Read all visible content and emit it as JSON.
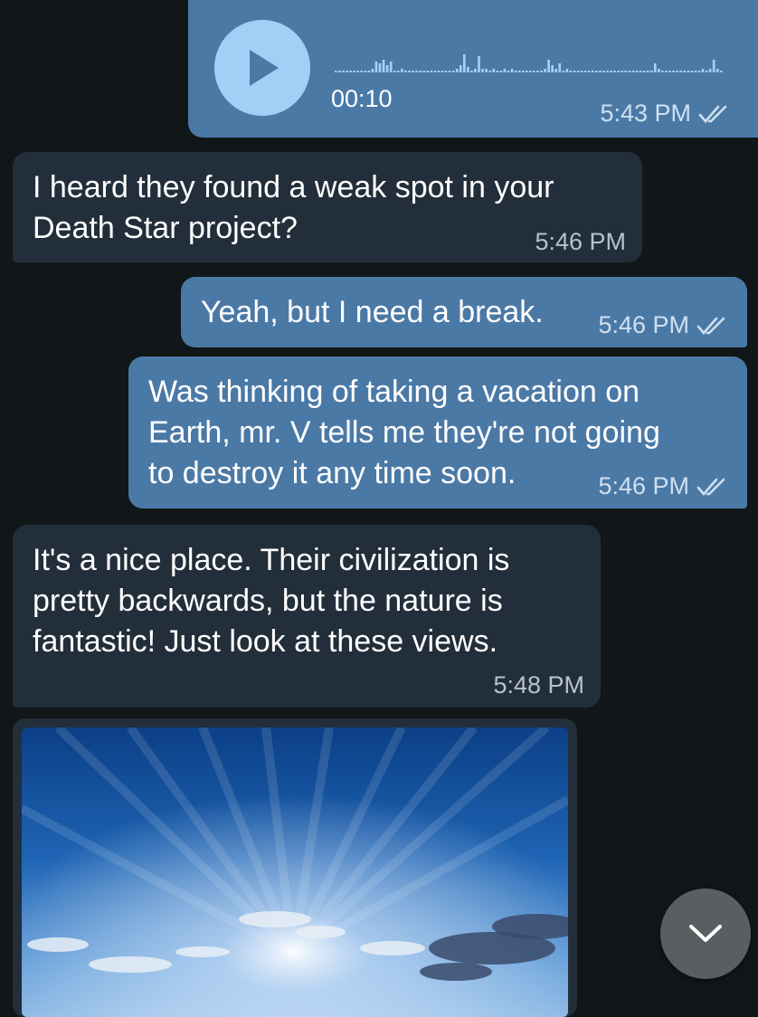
{
  "voice_message": {
    "duration": "00:10",
    "time": "5:43 PM",
    "play_icon": "play-icon",
    "status_icon": "double-check-icon"
  },
  "messages": [
    {
      "direction": "incoming",
      "text": "I heard they found a weak spot in your\nDeath Star project?",
      "time": "5:46 PM"
    },
    {
      "direction": "outgoing",
      "text": "Yeah, but I need a break.",
      "time": "5:46 PM",
      "status_icon": "double-check-icon"
    },
    {
      "direction": "outgoing",
      "text": "Was thinking of taking a vacation on\nEarth, mr. V tells me they're not going\nto destroy it any time soon.",
      "time": "5:46 PM",
      "status_icon": "double-check-icon"
    },
    {
      "direction": "incoming",
      "text": "It's a nice place. Their civilization is\npretty backwards, but the nature is\nfantastic! Just look at these views.",
      "time": "5:48 PM"
    }
  ],
  "photo_message": {
    "direction": "incoming",
    "content": "sky-photo"
  },
  "scroll_down_icon": "chevron-down-icon",
  "colors": {
    "background": "#111718",
    "outgoing_bubble": "#4b79a6",
    "incoming_bubble": "#232e3b",
    "play_button": "#a3cff7",
    "scroll_button": "#5a5e60"
  }
}
